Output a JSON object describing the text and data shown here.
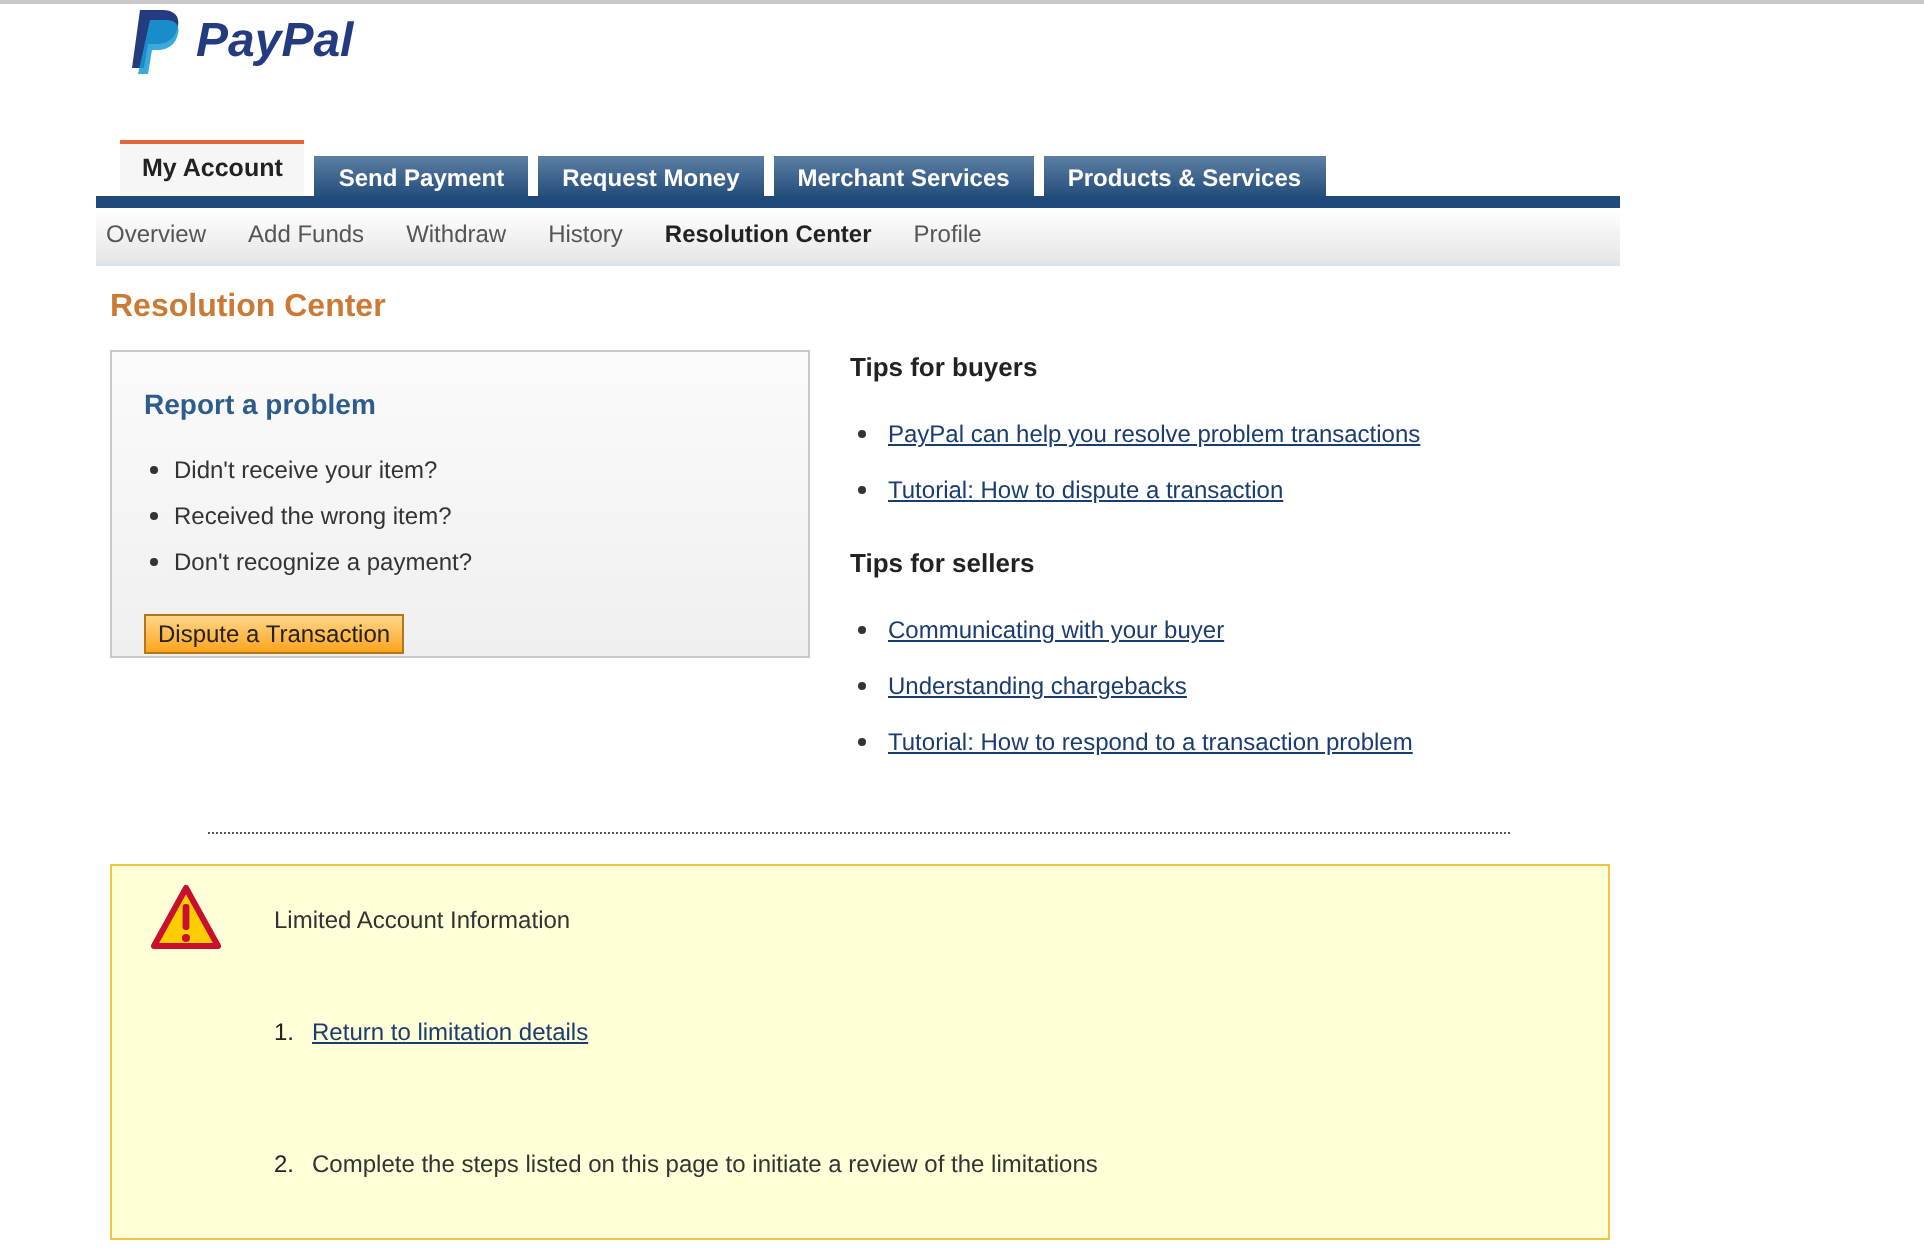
{
  "logo": {
    "text": "PayPal"
  },
  "tabs": [
    {
      "label": "My Account",
      "selected": true
    },
    {
      "label": "Send Payment",
      "selected": false
    },
    {
      "label": "Request Money",
      "selected": false
    },
    {
      "label": "Merchant Services",
      "selected": false
    },
    {
      "label": "Products & Services",
      "selected": false
    }
  ],
  "subnav": [
    {
      "label": "Overview",
      "selected": false
    },
    {
      "label": "Add Funds",
      "selected": false
    },
    {
      "label": "Withdraw",
      "selected": false
    },
    {
      "label": "History",
      "selected": false
    },
    {
      "label": "Resolution Center",
      "selected": true
    },
    {
      "label": "Profile",
      "selected": false
    }
  ],
  "page_title": "Resolution Center",
  "report": {
    "title": "Report a problem",
    "items": [
      "Didn't receive your item?",
      "Received the wrong item?",
      "Don't recognize a payment?"
    ],
    "button": "Dispute a Transaction"
  },
  "tips": [
    {
      "title": "Tips for buyers",
      "links": [
        "PayPal can help you resolve problem transactions",
        "Tutorial: How to dispute a transaction"
      ]
    },
    {
      "title": "Tips for sellers",
      "links": [
        "Communicating with your buyer",
        "Understanding chargebacks",
        "Tutorial: How to respond to a transaction problem"
      ]
    }
  ],
  "notice": {
    "title": "Limited Account Information",
    "steps": [
      {
        "number": "1.",
        "kind": "link",
        "text": "Return to limitation details"
      },
      {
        "number": "2.",
        "kind": "text",
        "text": "Complete the steps listed on this page to initiate a review of the limitations"
      }
    ]
  }
}
